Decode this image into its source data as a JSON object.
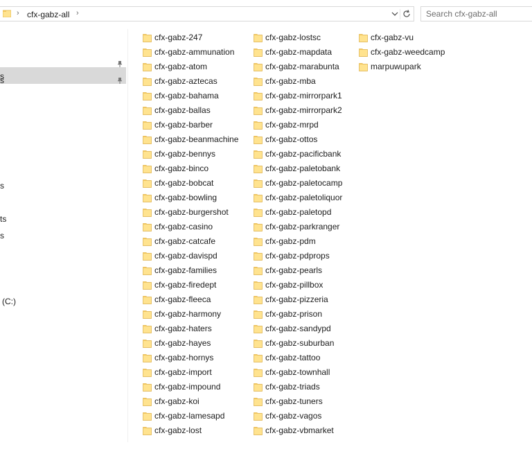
{
  "address_bar": {
    "crumbs": [
      "cfx-gabz-all"
    ]
  },
  "search": {
    "placeholder": "Search cfx-gabz-all"
  },
  "nav_pane": {
    "items": [
      {
        "label": "s",
        "selected": true,
        "pinned": false
      },
      {
        "label": "",
        "selected": false,
        "pinned": true
      },
      {
        "label": "s",
        "selected": false,
        "pinned": true
      },
      {
        "label": "s",
        "selected": false,
        "pinned": false
      },
      {
        "label": "ts",
        "selected": false,
        "pinned": false
      },
      {
        "label": "s",
        "selected": false,
        "pinned": false
      },
      {
        "label": "(C:)",
        "selected": false,
        "pinned": false
      }
    ]
  },
  "folders": {
    "columns": [
      [
        "cfx-gabz-247",
        "cfx-gabz-ammunation",
        "cfx-gabz-atom",
        "cfx-gabz-aztecas",
        "cfx-gabz-bahama",
        "cfx-gabz-ballas",
        "cfx-gabz-barber",
        "cfx-gabz-beanmachine",
        "cfx-gabz-bennys",
        "cfx-gabz-binco",
        "cfx-gabz-bobcat",
        "cfx-gabz-bowling",
        "cfx-gabz-burgershot",
        "cfx-gabz-casino",
        "cfx-gabz-catcafe",
        "cfx-gabz-davispd",
        "cfx-gabz-families",
        "cfx-gabz-firedept",
        "cfx-gabz-fleeca",
        "cfx-gabz-harmony",
        "cfx-gabz-haters",
        "cfx-gabz-hayes",
        "cfx-gabz-hornys",
        "cfx-gabz-import",
        "cfx-gabz-impound",
        "cfx-gabz-koi",
        "cfx-gabz-lamesapd",
        "cfx-gabz-lost"
      ],
      [
        "cfx-gabz-lostsc",
        "cfx-gabz-mapdata",
        "cfx-gabz-marabunta",
        "cfx-gabz-mba",
        "cfx-gabz-mirrorpark1",
        "cfx-gabz-mirrorpark2",
        "cfx-gabz-mrpd",
        "cfx-gabz-ottos",
        "cfx-gabz-pacificbank",
        "cfx-gabz-paletobank",
        "cfx-gabz-paletocamp",
        "cfx-gabz-paletoliquor",
        "cfx-gabz-paletopd",
        "cfx-gabz-parkranger",
        "cfx-gabz-pdm",
        "cfx-gabz-pdprops",
        "cfx-gabz-pearls",
        "cfx-gabz-pillbox",
        "cfx-gabz-pizzeria",
        "cfx-gabz-prison",
        "cfx-gabz-sandypd",
        "cfx-gabz-suburban",
        "cfx-gabz-tattoo",
        "cfx-gabz-townhall",
        "cfx-gabz-triads",
        "cfx-gabz-tuners",
        "cfx-gabz-vagos",
        "cfx-gabz-vbmarket"
      ],
      [
        "cfx-gabz-vu",
        "cfx-gabz-weedcamp",
        "marpuwupark"
      ]
    ]
  },
  "colors": {
    "folder_fill": "#ffe38f",
    "folder_tab": "#f2c55c",
    "selection": "#d9d9d9",
    "border": "#d9d9d9"
  }
}
